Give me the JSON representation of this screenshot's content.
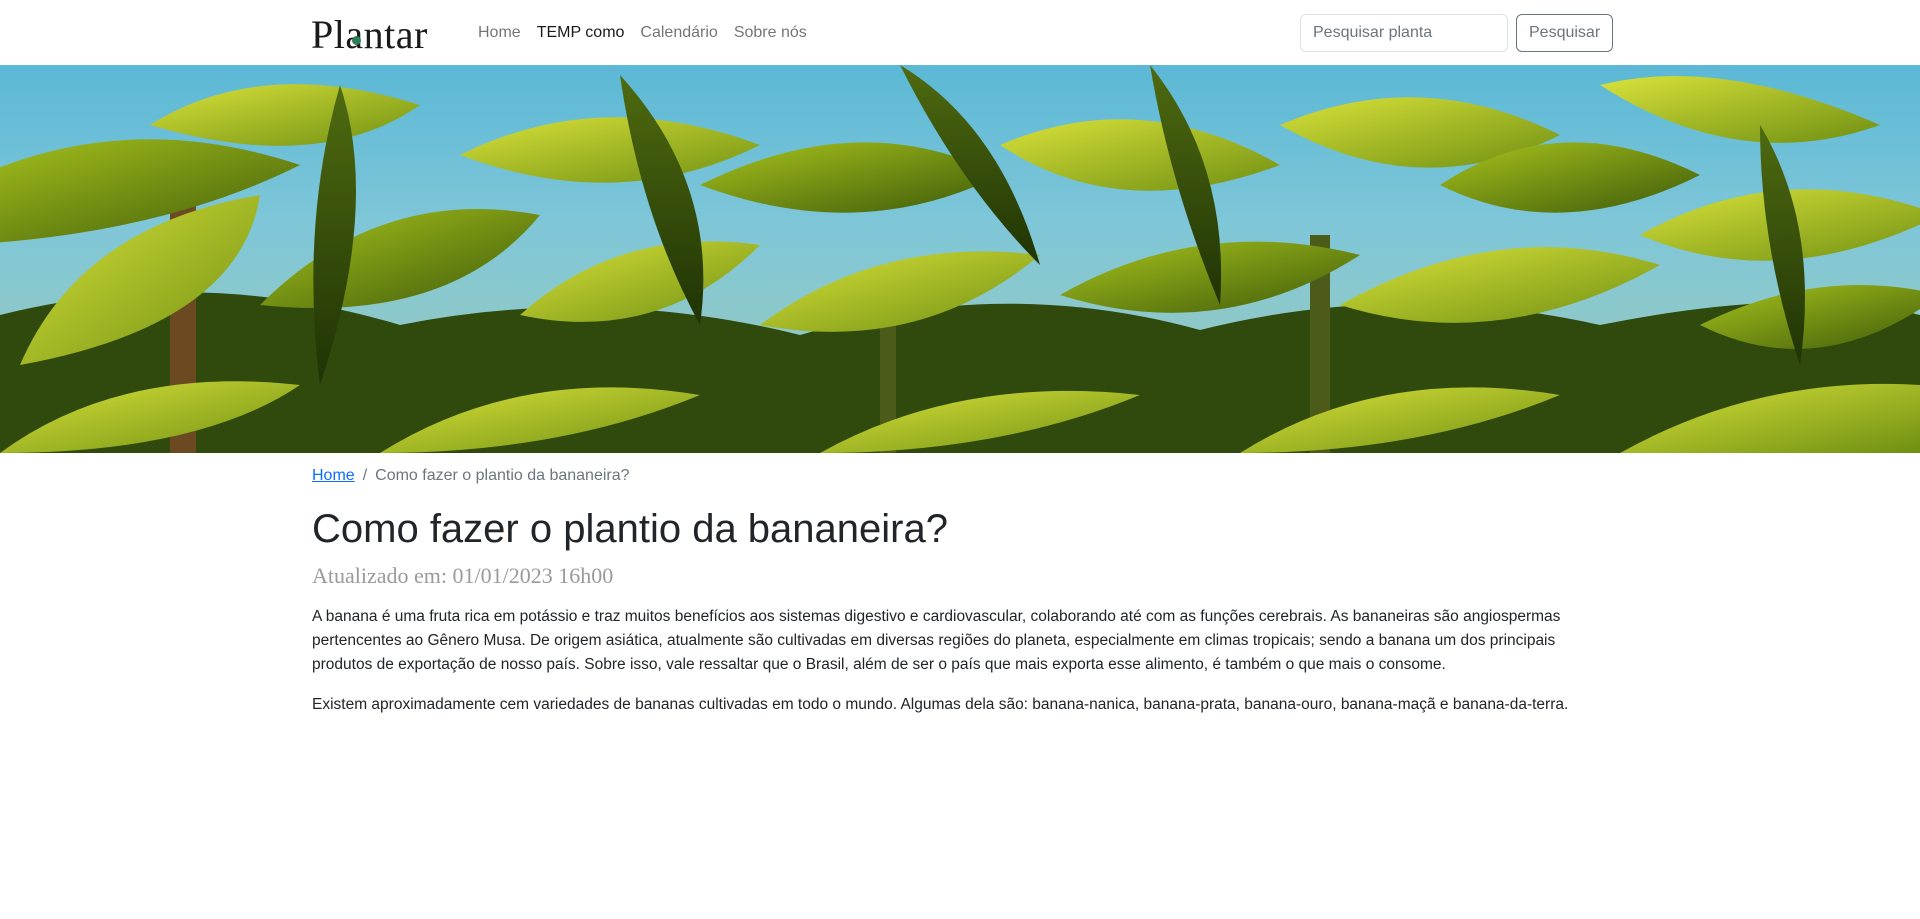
{
  "brand": {
    "name": "Plantar"
  },
  "nav": {
    "links": [
      {
        "label": "Home"
      },
      {
        "label": "TEMP como"
      },
      {
        "label": "Calendário"
      },
      {
        "label": "Sobre nós"
      }
    ]
  },
  "search": {
    "placeholder": "Pesquisar planta",
    "button_label": "Pesquisar"
  },
  "breadcrumb": {
    "home": "Home",
    "separator": "/",
    "current": "Como fazer o plantio da bananeira?"
  },
  "article": {
    "title": "Como fazer o plantio da bananeira?",
    "updated": "Atualizado em: 01/01/2023 16h00",
    "paragraphs": [
      "A banana é uma fruta rica em potássio e traz muitos benefícios aos sistemas digestivo e cardiovascular, colaborando até com as funções cerebrais. As bananeiras são angiospermas pertencentes ao Gênero Musa. De origem asiática, atualmente são cultivadas em diversas regiões do planeta, especialmente em climas tropicais; sendo a banana um dos principais produtos de exportação de nosso país. Sobre isso, vale ressaltar que o Brasil, além de ser o país que mais exporta esse alimento, é também o que mais o consome.",
      "Existem aproximadamente cem variedades de bananas cultivadas em todo o mundo. Algumas dela são: banana-nanica, banana-prata, banana-ouro, banana-maçã e banana-da-terra."
    ]
  },
  "colors": {
    "link": "#0d6efd",
    "muted": "#6c757d",
    "sky": "#5bb8d6",
    "leaf_light": "#c8d62a",
    "leaf_dark": "#2f4a0c"
  }
}
